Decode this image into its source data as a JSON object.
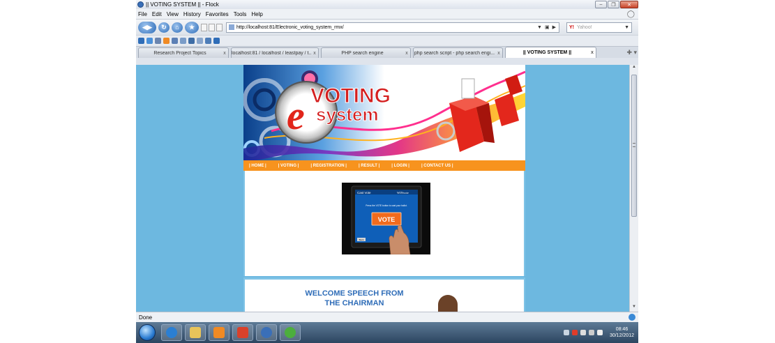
{
  "window": {
    "title": "|| VOTING SYSTEM || - Flock"
  },
  "menu": [
    "File",
    "Edit",
    "View",
    "History",
    "Favorites",
    "Tools",
    "Help"
  ],
  "address": {
    "url": "http://localhost:81/Electronic_voting_system_rmx/"
  },
  "search": {
    "placeholder": "Yahoo!"
  },
  "tabs": [
    {
      "label": "Research Project Topics"
    },
    {
      "label": "localhost:81 / localhost / leastpay / t..."
    },
    {
      "label": "PHP search engine"
    },
    {
      "label": "php search script - php search engi..."
    },
    {
      "label": "|| VOTING SYSTEM ||"
    }
  ],
  "site": {
    "logo_e": "e",
    "logo_voting": "VOTING",
    "logo_system": "system",
    "nav": [
      "| HOME |",
      "| VOTING |",
      "| REGISTRATION |",
      "| RESULT |",
      "| LOGIN |",
      "| CONTACT US |"
    ],
    "vote_screen": {
      "header": "Cast Vote",
      "brand": "WINvote",
      "instruction": "Press the VOTE button to cast your ballot.",
      "button": "VOTE",
      "back": "Back"
    },
    "welcome_title": "WELCOME SPEECH FROM THE CHAIRMAN"
  },
  "status": {
    "text": "Done"
  },
  "clock": {
    "time": "08:46",
    "date": "30/12/2012"
  },
  "colors": {
    "page_bg": "#6db8e0",
    "nav_orange": "#f7931e",
    "heading_blue": "#2f6db8"
  }
}
